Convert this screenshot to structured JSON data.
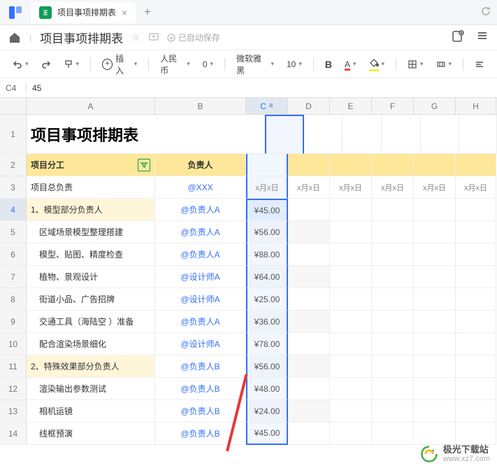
{
  "tab": {
    "title": "项目事项排期表"
  },
  "doc": {
    "title": "项目事项排期表",
    "autosave_prefix": "已自动保存"
  },
  "toolbar": {
    "insert": "插入",
    "currency": "人民币",
    "decimals": "0",
    "font": "微软雅黑",
    "size": "10",
    "bold": "B",
    "a": "A"
  },
  "namebox": {
    "ref": "C4",
    "value": "45"
  },
  "cols": [
    "A",
    "B",
    "C",
    "D",
    "E",
    "F",
    "G",
    "H"
  ],
  "rownums": [
    "1",
    "2",
    "3",
    "4",
    "5",
    "6",
    "7",
    "8",
    "9",
    "10",
    "11",
    "12",
    "13",
    "14"
  ],
  "title_row": "项目事项排期表",
  "headers": {
    "a": "项目分工",
    "b": "负责人"
  },
  "dateheader": "x月x日",
  "rows": [
    {
      "a": "项目总负责",
      "b": "@XXX",
      "c": "",
      "light": false
    },
    {
      "a": "1、模型部分负责人",
      "b": "@负责人A",
      "c": "¥45.00",
      "light": true
    },
    {
      "a": "　区域场景模型整理搭建",
      "b": "@负责人A",
      "c": "¥56.00",
      "light": false
    },
    {
      "a": "　模型、贴图、精度检查",
      "b": "@负责人A",
      "c": "¥88.00",
      "light": false
    },
    {
      "a": "　植物、景观设计",
      "b": "@设计师A",
      "c": "¥64.00",
      "light": false
    },
    {
      "a": "　街道小品、广告招牌",
      "b": "@设计师A",
      "c": "¥25.00",
      "light": false
    },
    {
      "a": "　交通工具（海陆空 ）准备",
      "b": "@负责人A",
      "c": "¥36.00",
      "light": false
    },
    {
      "a": "　配合渲染场景细化",
      "b": "@设计师A",
      "c": "¥78.00",
      "light": false
    },
    {
      "a": "2、特殊效果部分负责人",
      "b": "@负责人B",
      "c": "¥56.00",
      "light": true
    },
    {
      "a": "　渲染输出参数测试",
      "b": "@负责人B",
      "c": "¥48.00",
      "light": false
    },
    {
      "a": "　相机运镜",
      "b": "@负责人B",
      "c": "¥24.00",
      "light": false
    },
    {
      "a": "　线框预演",
      "b": "@负责人B",
      "c": "¥45.00",
      "light": false
    }
  ],
  "watermark": {
    "cn": "极光下载站",
    "url": "www.xz7.com"
  }
}
